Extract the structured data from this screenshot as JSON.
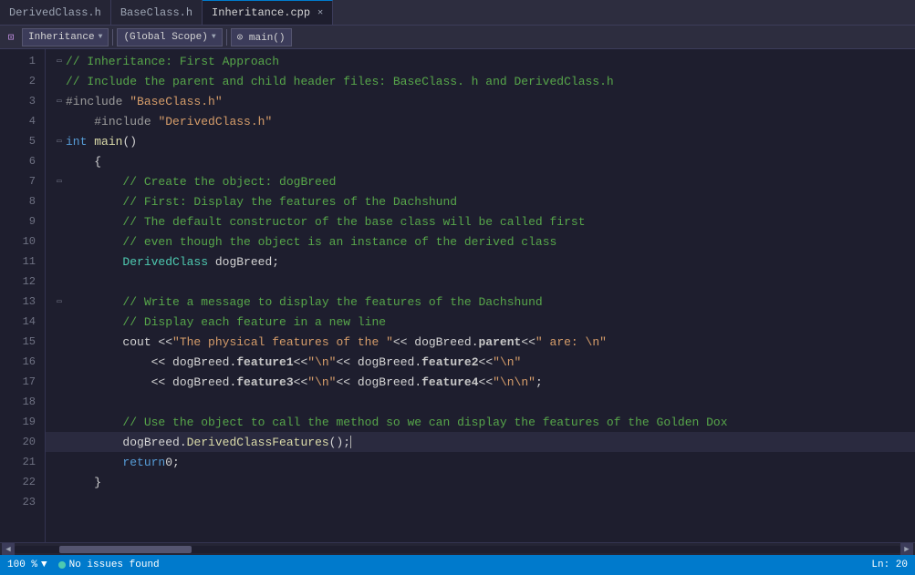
{
  "tabs": [
    {
      "id": "derivedclass",
      "label": "DerivedClass.h",
      "active": false,
      "modified": false
    },
    {
      "id": "baseclass",
      "label": "BaseClass.h",
      "active": false,
      "modified": false
    },
    {
      "id": "inheritance",
      "label": "Inheritance.cpp",
      "active": true,
      "modified": true
    }
  ],
  "toolbar": {
    "scope_label": "Inheritance",
    "scope_arrow": "▼",
    "global_scope": "(Global Scope)",
    "global_arrow": "▼",
    "main_func": "⊙ main()"
  },
  "lines": [
    {
      "num": 1,
      "fold": "▭",
      "content": "comment1"
    },
    {
      "num": 2,
      "fold": "",
      "content": "comment2"
    },
    {
      "num": 3,
      "fold": "▭",
      "content": "include1"
    },
    {
      "num": 4,
      "fold": "",
      "content": "include2"
    },
    {
      "num": 5,
      "fold": "▭",
      "content": "int_main"
    },
    {
      "num": 6,
      "fold": "",
      "content": "open_brace"
    },
    {
      "num": 7,
      "fold": "▭",
      "content": "comment_create"
    },
    {
      "num": 8,
      "fold": "",
      "content": "comment_first"
    },
    {
      "num": 9,
      "fold": "",
      "content": "comment_default"
    },
    {
      "num": 10,
      "fold": "",
      "content": "comment_even"
    },
    {
      "num": 11,
      "fold": "",
      "content": "derivedclass_decl"
    },
    {
      "num": 12,
      "fold": "",
      "content": "blank"
    },
    {
      "num": 13,
      "fold": "▭",
      "content": "comment_write"
    },
    {
      "num": 14,
      "fold": "",
      "content": "comment_display"
    },
    {
      "num": 15,
      "fold": "",
      "content": "cout_line"
    },
    {
      "num": 16,
      "fold": "",
      "content": "feature12_line"
    },
    {
      "num": 17,
      "fold": "",
      "content": "feature34_line"
    },
    {
      "num": 18,
      "fold": "",
      "content": "blank"
    },
    {
      "num": 19,
      "fold": "",
      "content": "comment_use"
    },
    {
      "num": 20,
      "fold": "",
      "content": "dogbreed_derived"
    },
    {
      "num": 21,
      "fold": "",
      "content": "return_line"
    },
    {
      "num": 22,
      "fold": "",
      "content": "close_brace"
    },
    {
      "num": 23,
      "fold": "",
      "content": "blank"
    }
  ],
  "status": {
    "zoom": "100 %",
    "issues": "No issues found",
    "line": "Ln: 20",
    "zoom_arrow": "▼"
  }
}
